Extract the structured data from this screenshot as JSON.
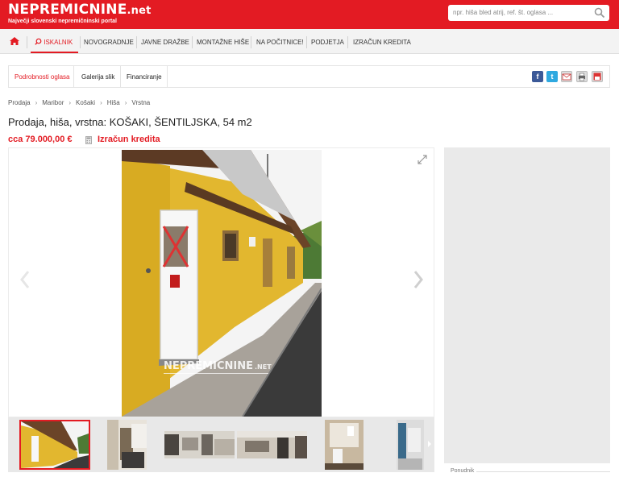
{
  "header": {
    "logo_main": "NEPREMICNINE",
    "logo_suffix": ".net",
    "tagline": "Največji slovenski nepremičninski portal",
    "search_placeholder": "npr. hiša bled atrij, ref. št. oglasa ..."
  },
  "nav": {
    "items": [
      {
        "label": "ISKALNIK"
      },
      {
        "label": "NOVOGRADNJE"
      },
      {
        "label": "JAVNE DRAŽBE"
      },
      {
        "label": "MONTAŽNE HIŠE"
      },
      {
        "label": "NA POČITNICE!"
      },
      {
        "label": "PODJETJA"
      },
      {
        "label": "IZRAČUN KREDITA"
      }
    ]
  },
  "tabs": [
    {
      "label": "Podrobnosti oglasa"
    },
    {
      "label": "Galerija slik"
    },
    {
      "label": "Financiranje"
    }
  ],
  "share_icons": [
    "facebook-icon",
    "twitter-icon",
    "email-icon",
    "print-icon",
    "save-icon"
  ],
  "breadcrumb": [
    "Prodaja",
    "Maribor",
    "Košaki",
    "Hiša",
    "Vrstna"
  ],
  "listing": {
    "title": "Prodaja, hiša, vrstna: KOŠAKI, ŠENTILJSKA, 54 m2",
    "price": "cca 79.000,00 €",
    "loan_link": "Izračun kredita"
  },
  "watermark": {
    "main": "NEPREMICNINE",
    "suffix": ".NET"
  },
  "sidebar": {
    "ponudnik_label": "Ponudnik"
  },
  "colors": {
    "brand_red": "#e31b23",
    "house_yellow": "#e3b92e"
  }
}
